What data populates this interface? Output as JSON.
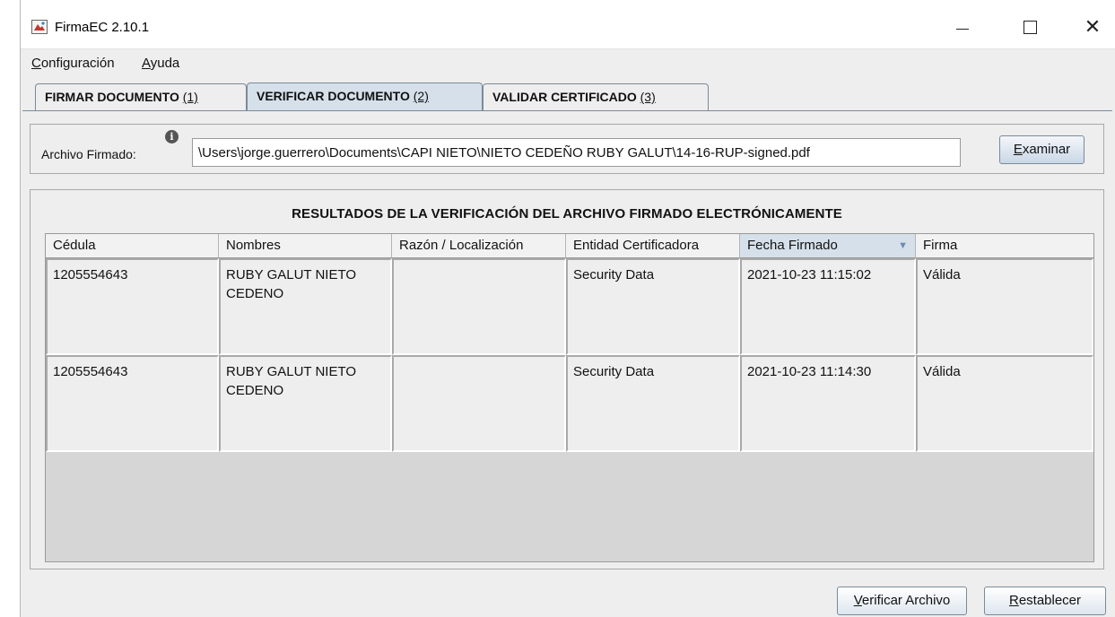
{
  "window": {
    "title": "FirmaEC 2.10.1",
    "controls": {
      "minimize": "",
      "maximize": "",
      "close": "✕"
    }
  },
  "menubar": {
    "configuracion": {
      "mnemonic": "C",
      "rest": "onfiguración"
    },
    "ayuda": {
      "mnemonic": "A",
      "rest": "yuda"
    }
  },
  "tabs": [
    {
      "label": "FIRMAR DOCUMENTO ",
      "key": "(1)",
      "active": false
    },
    {
      "label": "VERIFICAR DOCUMENTO ",
      "key": "(2)",
      "active": true
    },
    {
      "label": "VALIDAR CERTIFICADO ",
      "key": "(3)",
      "active": false
    }
  ],
  "file": {
    "label": "Archivo Firmado:",
    "info_icon": "info-icon",
    "value": "\\Users\\jorge.guerrero\\Documents\\CAPI NIETO\\NIETO CEDEÑO RUBY GALUT\\14-16-RUP-signed.pdf",
    "browse": {
      "mnemonic": "E",
      "rest": "xaminar"
    }
  },
  "results": {
    "title": "RESULTADOS DE LA VERIFICACIÓN DEL ARCHIVO FIRMADO ELECTRÓNICAMENTE",
    "columns": [
      "Cédula",
      "Nombres",
      "Razón / Localización",
      "Entidad Certificadora",
      "Fecha Firmado",
      "Firma"
    ],
    "sort_indicator": "▼",
    "rows": [
      [
        "1205554643",
        "RUBY GALUT NIETO CEDENO",
        "",
        "Security Data",
        "2021-10-23 11:15:02",
        "Válida"
      ],
      [
        "1205554643",
        "RUBY GALUT NIETO CEDENO",
        "",
        "Security Data",
        "2021-10-23 11:14:30",
        "Válida"
      ]
    ]
  },
  "actions": {
    "verify": {
      "mnemonic": "V",
      "rest": "erificar Archivo"
    },
    "reset": {
      "mnemonic": "R",
      "rest": "establecer"
    }
  },
  "colors": {
    "window_bg": "#eeeeee",
    "tab_active": "#d5e0ea",
    "sorted_header": "#d5e0ea",
    "border": "#7a8a99"
  }
}
